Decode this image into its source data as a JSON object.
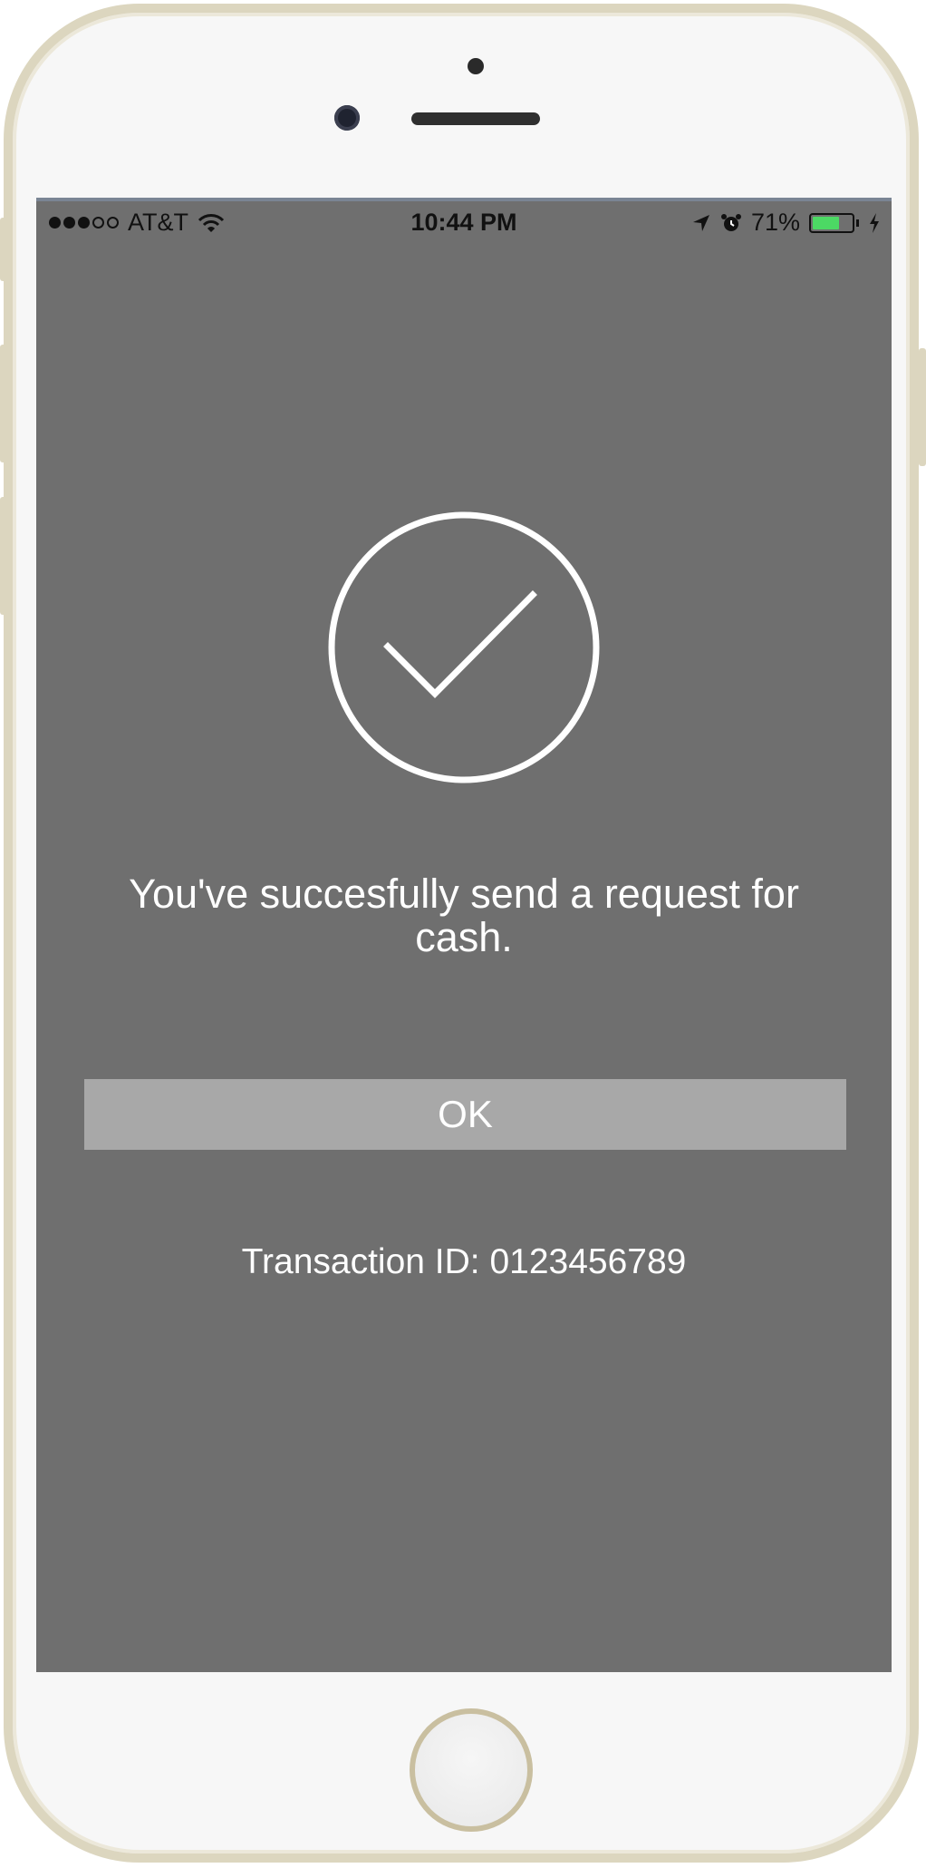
{
  "status_bar": {
    "carrier": "AT&T",
    "time": "10:44 PM",
    "battery_percent": "71%",
    "battery_level": 0.71,
    "battery_color": "#4cd964",
    "icons": [
      "signal-dots-icon",
      "wifi-icon",
      "location-arrow-icon",
      "alarm-icon",
      "battery-icon",
      "charging-bolt-icon"
    ]
  },
  "success": {
    "icon": "checkmark-circle-icon",
    "message": "You've succesfully send a request for cash.",
    "ok_label": "OK",
    "transaction_label": "Transaction ID: 0123456789"
  },
  "colors": {
    "screen_background": "#6f6f6f",
    "button_background": "#a8a8a8",
    "text": "#ffffff"
  }
}
